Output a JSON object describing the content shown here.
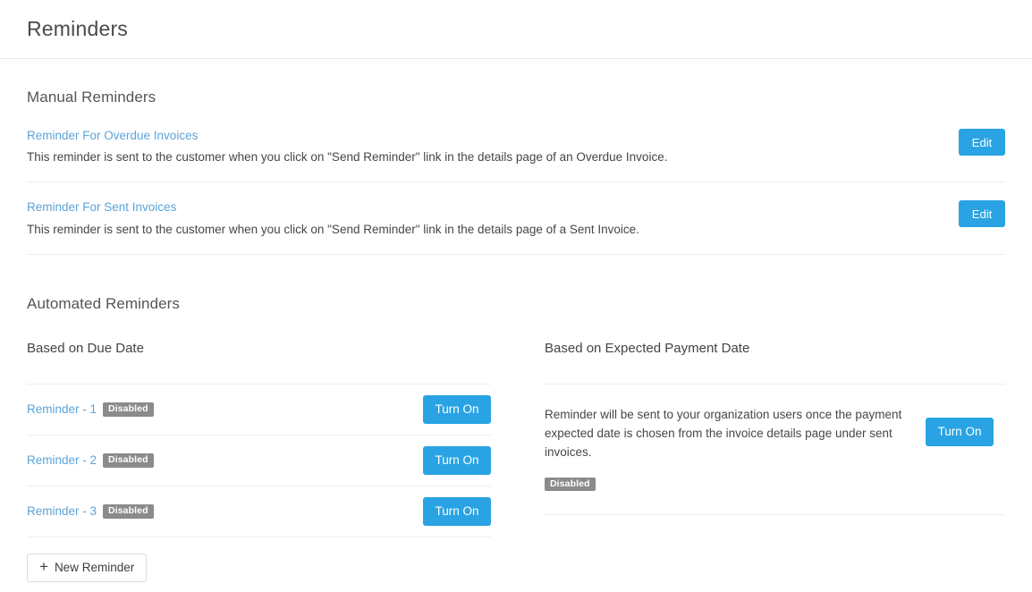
{
  "header": {
    "title": "Reminders"
  },
  "manual": {
    "heading": "Manual Reminders",
    "items": [
      {
        "link": "Reminder For Overdue Invoices",
        "description": "This reminder is sent to the customer when you click on \"Send Reminder\" link in the details page of an Overdue Invoice.",
        "button": "Edit"
      },
      {
        "link": "Reminder For Sent Invoices",
        "description": "This reminder is sent to the customer when you click on \"Send Reminder\" link in the details page of a Sent Invoice.",
        "button": "Edit"
      }
    ]
  },
  "automated": {
    "heading": "Automated Reminders",
    "due_date": {
      "heading": "Based on Due Date",
      "rows": [
        {
          "link": "Reminder - 1",
          "badge": "Disabled",
          "button": "Turn On"
        },
        {
          "link": "Reminder - 2",
          "badge": "Disabled",
          "button": "Turn On"
        },
        {
          "link": "Reminder - 3",
          "badge": "Disabled",
          "button": "Turn On"
        }
      ],
      "new_reminder_label": "New Reminder",
      "new_reminder_icon": "+"
    },
    "expected_payment": {
      "heading": "Based on Expected Payment Date",
      "description": "Reminder will be sent to your organization users once the payment expected date is chosen from the invoice details page under sent invoices.",
      "badge": "Disabled",
      "button": "Turn On"
    }
  },
  "colors": {
    "accent": "#29a3e3",
    "link": "#5ba4d8",
    "badge_disabled": "#8b8b8b",
    "divider": "#eeeeee"
  }
}
